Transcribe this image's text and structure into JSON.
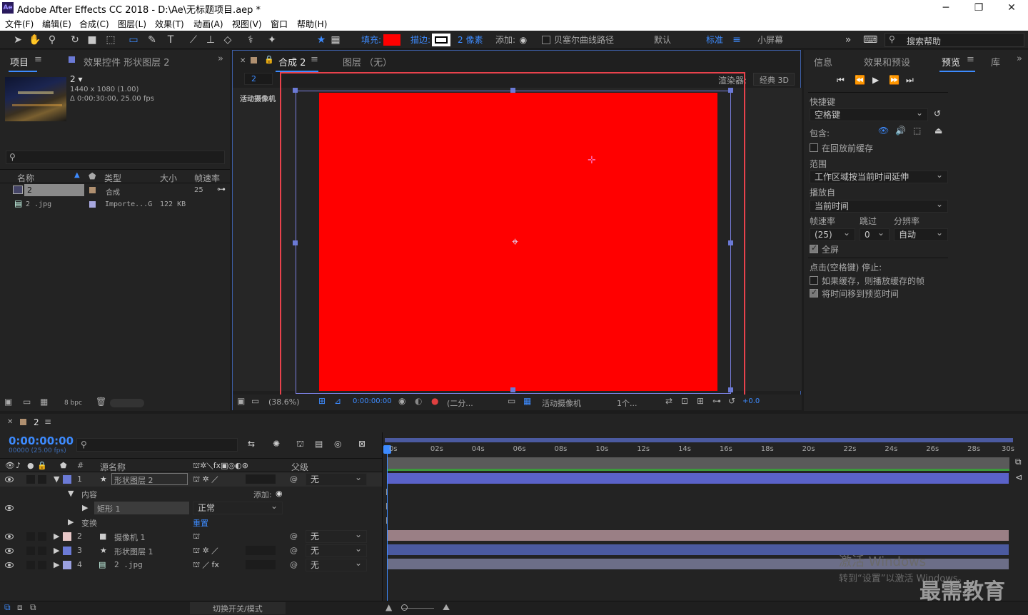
{
  "window": {
    "app_icon": "Ae",
    "title": "Adobe After Effects CC 2018 - D:\\Ae\\无标题项目.aep *",
    "min": "─",
    "max": "❐",
    "close": "✕"
  },
  "menu": [
    "文件(F)",
    "编辑(E)",
    "合成(C)",
    "图层(L)",
    "效果(T)",
    "动画(A)",
    "视图(V)",
    "窗口",
    "帮助(H)"
  ],
  "toolbar": {
    "fill_label": "填充:",
    "stroke_label": "描边:",
    "stroke_width": "2 像素",
    "add_label": "添加:",
    "bezier_label": "贝塞尔曲线路径",
    "ws_default": "默认",
    "ws_standard": "标准",
    "ws_small": "小屏幕",
    "search_placeholder": "搜索帮助",
    "fill_color": "#ff0000"
  },
  "project": {
    "tab": "项目",
    "effects_tab": "效果控件 形状图层 2",
    "comp_name": "2 ▾",
    "comp_size": "1440 x 1080 (1.00)",
    "comp_dur": "Δ 0:00:30:00, 25.00 fps",
    "search_placeholder": "",
    "col_name": "名称",
    "col_type": "类型",
    "col_size": "大小",
    "col_fps": "帧速率",
    "items": [
      {
        "name": "2",
        "type": "合成",
        "size": "",
        "fps": "25"
      },
      {
        "name": "2 .jpg",
        "type": "Importe...G",
        "size": "122 KB",
        "fps": ""
      }
    ],
    "bpc": "8 bpc"
  },
  "viewer": {
    "tab_comp": "合成 2",
    "tab_layer": "图层 （无）",
    "comp_label": "2",
    "renderer_label": "渲染器:",
    "renderer": "经典 3D",
    "camera_label": "活动摄像机",
    "zoom": "(38.6%)",
    "time": "0:00:00:00",
    "res": "(二分...",
    "camera_select": "活动摄像机",
    "views": "1个...",
    "exposure": "+0.0"
  },
  "right": {
    "tab_info": "信息",
    "tab_effects": "效果和预设",
    "tab_preview": "预览",
    "tab_lib": "库",
    "shortcut_label": "快捷键",
    "shortcut": "空格键",
    "include_label": "包含:",
    "cache_before": "在回放前缓存",
    "range_label": "范围",
    "range": "工作区域按当前时间延伸",
    "play_from_label": "播放自",
    "play_from": "当前时间",
    "fps_label": "帧速率",
    "skip_label": "跳过",
    "res_label": "分辨率",
    "fps": "(25)",
    "skip": "0",
    "res": "自动",
    "fullscreen": "全屏",
    "stop_label": "点击(空格键) 停止:",
    "if_cache": "如果缓存，则播放缓存的帧",
    "move_time": "将时间移到预览时间"
  },
  "timeline": {
    "tab": "2",
    "timecode": "0:00:00:00",
    "frames": "00000 (25.00 fps)",
    "col_hash": "#",
    "col_source": "源名称",
    "col_parent": "父级",
    "switches": "切换开关/模式",
    "ticks": [
      "0s",
      "02s",
      "04s",
      "06s",
      "08s",
      "10s",
      "12s",
      "14s",
      "16s",
      "18s",
      "20s",
      "22s",
      "24s",
      "26s",
      "28s",
      "30s"
    ],
    "layers": [
      {
        "num": "1",
        "name": "形状图层 2",
        "parent": "无",
        "color": "#6b7ad6"
      },
      {
        "num": "2",
        "name": "摄像机 1",
        "parent": "无",
        "color": "#e8c8c8"
      },
      {
        "num": "3",
        "name": "形状图层 1",
        "parent": "无",
        "color": "#6b7ad6"
      },
      {
        "num": "4",
        "name": "2 .jpg",
        "parent": "无",
        "color": "#9aa0e0"
      }
    ],
    "content_label": "内容",
    "add_label": "添加:",
    "rect_label": "矩形 1",
    "blend": "正常",
    "transform_label": "变换",
    "reset": "重置"
  },
  "watermark": {
    "line1": "激活 Windows",
    "line2": "转到“设置”以激活 Windows。",
    "brand": "最需教育"
  }
}
